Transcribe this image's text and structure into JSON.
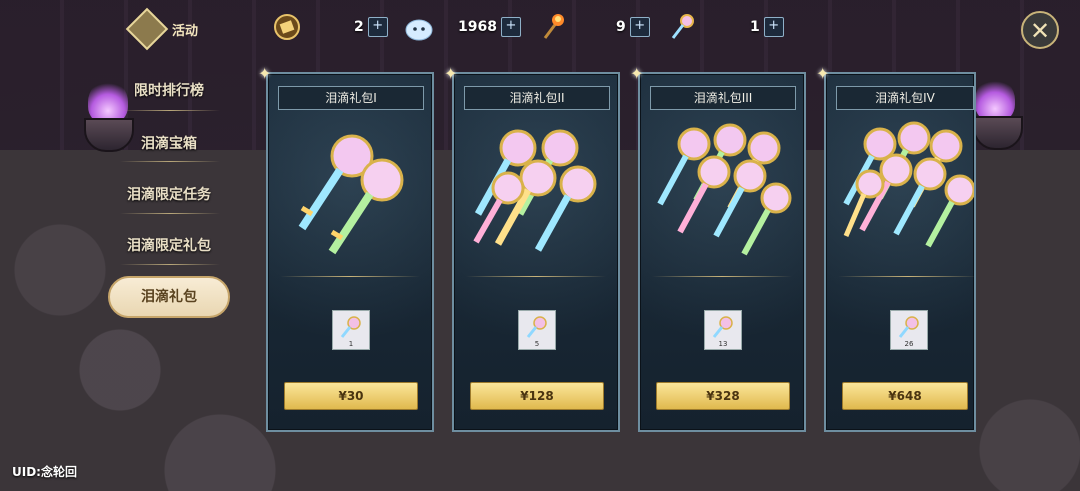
{
  "resources": [
    {
      "icon": "ticket-icon",
      "value": "2"
    },
    {
      "icon": "slime-icon",
      "value": "1968"
    },
    {
      "icon": "torch-icon",
      "value": "9"
    },
    {
      "icon": "key-icon",
      "value": "1"
    }
  ],
  "plus_symbol": "+",
  "close_symbol": "✕",
  "activity_label": "活动",
  "menu": {
    "items": [
      "限时排行榜",
      "泪滴宝箱",
      "泪滴限定任务",
      "泪滴限定礼包"
    ],
    "active": "泪滴礼包"
  },
  "packs": [
    {
      "title": "泪滴礼包I",
      "item_count": "1",
      "price": "¥30"
    },
    {
      "title": "泪滴礼包II",
      "item_count": "5",
      "price": "¥128"
    },
    {
      "title": "泪滴礼包III",
      "item_count": "13",
      "price": "¥328"
    },
    {
      "title": "泪滴礼包IV",
      "item_count": "26",
      "price": "¥648"
    }
  ],
  "uid": "UID:念轮回",
  "colors": {
    "accent_gold": "#e0b94e",
    "card_bg": "#1d2e3d",
    "card_border": "#6e8ea0"
  }
}
